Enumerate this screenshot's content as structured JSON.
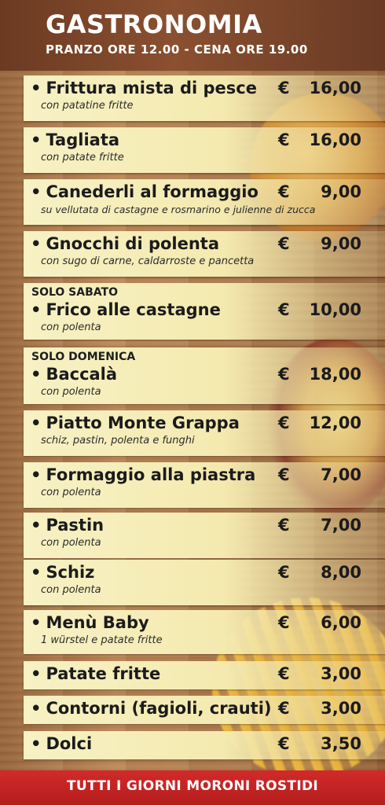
{
  "header": {
    "title": "GASTRONOMIA",
    "subtitle": "PRANZO ORE 12.00 - CENA ORE 19.00"
  },
  "currency": "€",
  "bullet": "•",
  "items": [
    {
      "name": "Frittura mista di pesce",
      "desc": "con patatine fritte",
      "price": "16,00"
    },
    {
      "name": "Tagliata",
      "desc": "con patate fritte",
      "price": "16,00"
    },
    {
      "name": "Canederli al formaggio",
      "desc": "su vellutata di castagne e rosmarino e julienne di zucca",
      "price": "9,00"
    },
    {
      "name": "Gnocchi di polenta",
      "desc": "con sugo di carne, caldarroste e pancetta",
      "price": "9,00"
    },
    {
      "day": "SOLO SABATO",
      "name": "Frico alle castagne",
      "desc": "con polenta",
      "price": "10,00"
    },
    {
      "day": "SOLO DOMENICA",
      "name": "Baccalà",
      "desc": "con polenta",
      "price": "18,00"
    },
    {
      "name": "Piatto Monte Grappa",
      "desc": "schiz, pastin, polenta e funghi",
      "price": "12,00"
    },
    {
      "name": "Formaggio alla piastra",
      "desc": "con polenta",
      "price": "7,00"
    },
    {
      "name": "Pastin",
      "desc": "con polenta",
      "price": "7,00"
    },
    {
      "name": "Schiz",
      "desc": "con polenta",
      "price": "8,00"
    },
    {
      "name": "Menù Baby",
      "desc": "1 würstel e patate fritte",
      "price": "6,00"
    },
    {
      "name": "Patate fritte",
      "price": "3,00"
    },
    {
      "name": "Contorni (fagioli, crauti)",
      "price": "3,00"
    },
    {
      "name": "Dolci",
      "price": "3,50"
    }
  ],
  "footer": "TUTTI I GIORNI MORONI ROSTIDI"
}
